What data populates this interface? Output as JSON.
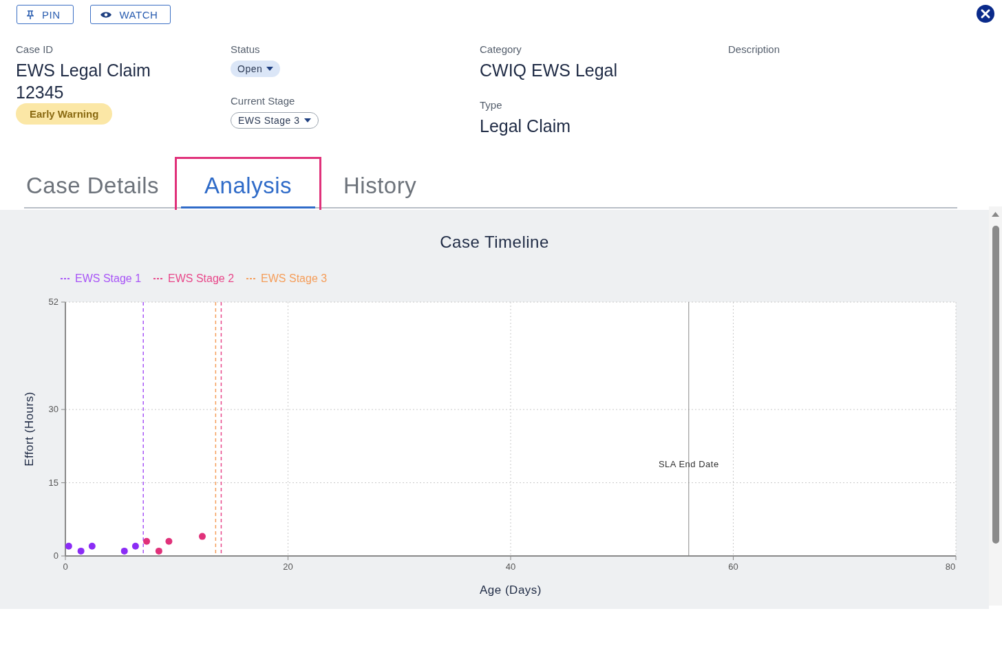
{
  "actions": [
    {
      "label": "PIN",
      "kind": "pin"
    },
    {
      "label": "WATCH",
      "kind": "watch"
    }
  ],
  "field_columns": [
    [
      {
        "label": "Case ID",
        "value": "EWS Legal Claim 12345",
        "badge": "Early Warning"
      }
    ],
    [
      {
        "label": "Status",
        "dropdown": "Open",
        "kind": "status"
      },
      {
        "label": "Current Stage",
        "dropdown": "EWS Stage 3",
        "kind": "stage"
      }
    ],
    [
      {
        "label": "Category",
        "value": "CWIQ EWS Legal"
      },
      {
        "label": "Type",
        "value": "Legal Claim"
      }
    ],
    [
      {
        "label": "Description"
      }
    ]
  ],
  "tabs": [
    {
      "label": "Case Details",
      "selected": false,
      "highlighted": false
    },
    {
      "label": "Analysis",
      "selected": true,
      "highlighted": true
    },
    {
      "label": "History",
      "selected": false,
      "highlighted": false
    }
  ],
  "chart": {
    "chart_data": {
      "type": "scatter",
      "title": "Case Timeline",
      "xlabel": "Age (Days)",
      "ylabel": "Effort (Hours)",
      "xlim": [
        0,
        80
      ],
      "ylim": [
        0,
        52
      ],
      "xticks": [
        0,
        20,
        40,
        60,
        80
      ],
      "yticks": [
        0,
        15,
        30,
        52
      ],
      "grid": true,
      "series": [
        {
          "color": "#8b2cf5",
          "x": [
            0.3,
            1.4,
            2.4,
            5.3,
            6.3
          ],
          "values": [
            2,
            1,
            2,
            1,
            2
          ]
        },
        {
          "color": "#e0317a",
          "x": [
            7.3,
            8.4,
            9.3,
            12.3
          ],
          "values": [
            3,
            1,
            3,
            4
          ]
        }
      ],
      "ref_lines": [
        {
          "axis": "x",
          "value": 7,
          "color": "#a855f7"
        },
        {
          "axis": "x",
          "value": 14,
          "color": "#e8488a"
        },
        {
          "axis": "x",
          "value": 13.5,
          "color": "#f59e5b"
        },
        {
          "axis": "x",
          "value": 56,
          "label": "SLA End Date",
          "color": "#888888"
        }
      ]
    },
    "legend": [
      {
        "label": "EWS Stage 1",
        "color": "#a855f7"
      },
      {
        "label": "EWS Stage 2",
        "color": "#e8488a"
      },
      {
        "label": "EWS Stage 3",
        "color": "#f59e5b"
      }
    ]
  }
}
